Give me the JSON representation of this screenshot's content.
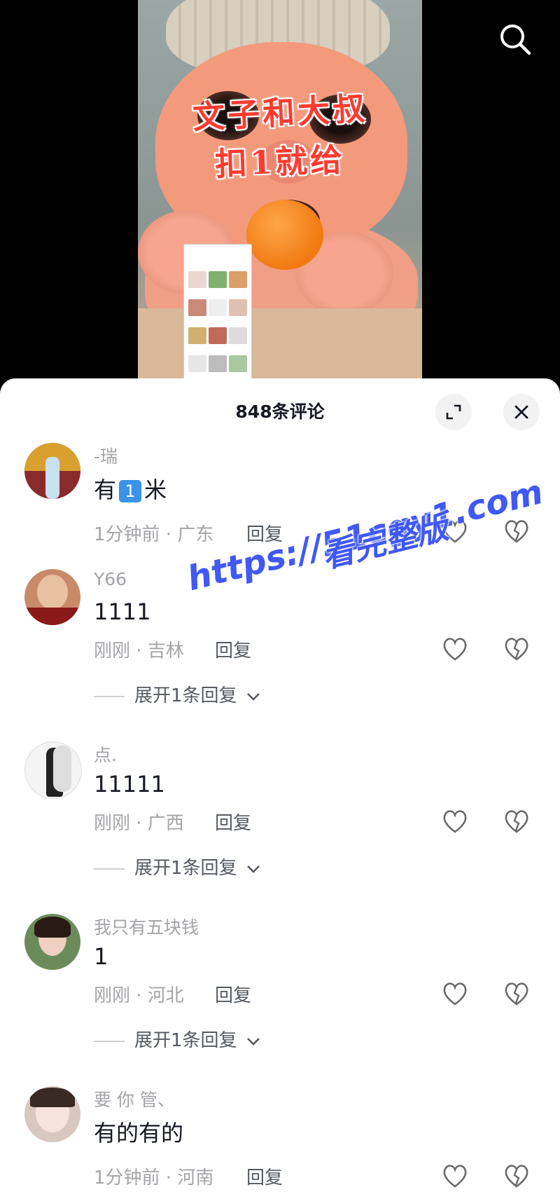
{
  "video": {
    "caption_line1": "文子和大叔",
    "caption_line2": "扣1就给"
  },
  "top_bar": {
    "search_icon": "search-icon"
  },
  "sheet": {
    "title": "848条评论",
    "expand_icon": "expand-icon",
    "close_icon": "close-icon"
  },
  "comments": [
    {
      "username": "-瑞",
      "content_prefix": "有",
      "content_emoji": "1",
      "content_suffix": "米",
      "meta": "1分钟前 · 广东",
      "reply_label": "回复",
      "avatar_color": "#8a2a2a",
      "expand_label": ""
    },
    {
      "username": "Y66",
      "content": "1111",
      "meta": "刚刚 · 吉林",
      "reply_label": "回复",
      "avatar_color": "#c98a6a",
      "expand_label": "展开1条回复"
    },
    {
      "username": "点.",
      "content": "11111",
      "meta": "刚刚 · 广西",
      "reply_label": "回复",
      "avatar_color": "#eeeeee",
      "expand_label": "展开1条回复"
    },
    {
      "username": "我只有五块钱",
      "content": "1",
      "meta": "刚刚 · 河北",
      "reply_label": "回复",
      "avatar_color": "#6b8b5a",
      "expand_label": "展开1条回复"
    },
    {
      "username": "要 你 管、",
      "content": "有的有的",
      "meta": "1分钟前 · 河南",
      "reply_label": "回复",
      "avatar_color": "#d9c8c0",
      "expand_label": ""
    }
  ],
  "watermark": {
    "line1": "https://51cgy1.com",
    "line2": "看完整版"
  }
}
